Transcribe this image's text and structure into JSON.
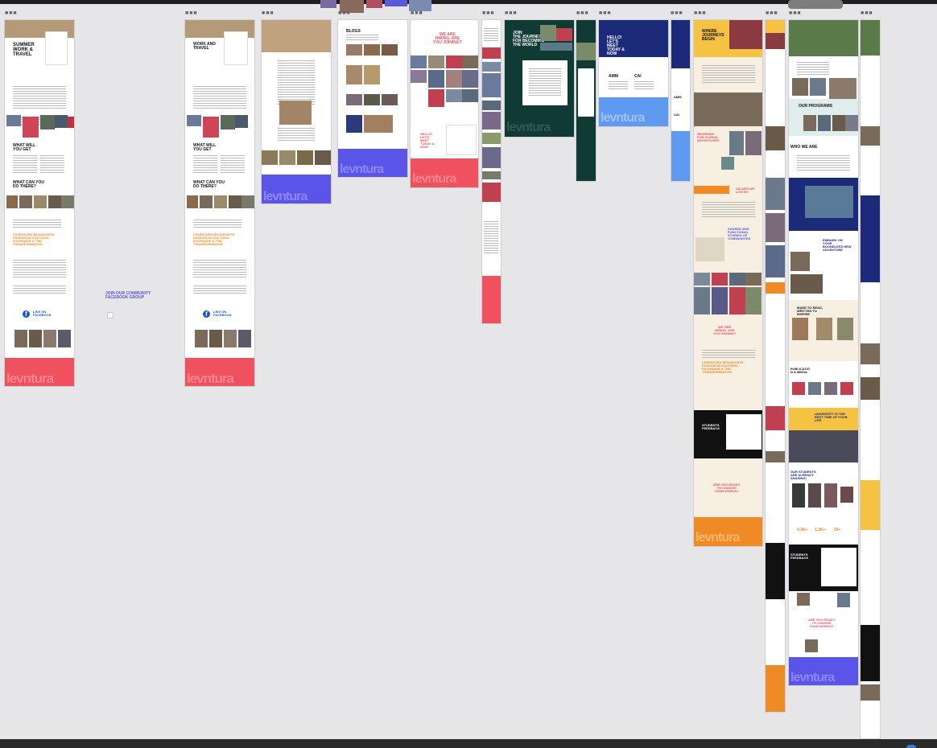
{
  "colors": {
    "canvas": "#e6e6e8",
    "coral": "#f0515f",
    "purple": "#5a54e8",
    "dark_green": "#0f3b34",
    "navy": "#1c2a7a",
    "orange": "#f08a24",
    "yellow": "#f5c242",
    "cream": "#f7efe2",
    "black": "#111111"
  },
  "frames": [
    {
      "label": "■■■",
      "kind": "landing-summer-work-travel"
    },
    {
      "label": "■■■",
      "kind": "landing-work-and-travel"
    },
    {
      "label": "■■■",
      "kind": "landing-cultural-exchange"
    },
    {
      "label": "■■■",
      "kind": "blogs"
    },
    {
      "label": "■■■",
      "kind": "we-are-hiring"
    },
    {
      "label": "■■■",
      "kind": "mobile-landing"
    },
    {
      "label": "■■■",
      "kind": "join-journey-dark"
    },
    {
      "label": "■■■",
      "kind": "mobile-dark"
    },
    {
      "label": "■■■",
      "kind": "contact-hello"
    },
    {
      "label": "■■■",
      "kind": "mobile-contact"
    },
    {
      "label": "■■■",
      "kind": "about-journeys"
    },
    {
      "label": "■■■",
      "kind": "mobile-about"
    },
    {
      "label": "■■■",
      "kind": "our-programs"
    },
    {
      "label": "■■■",
      "kind": "mobile-programs"
    }
  ],
  "text": {
    "summer_title": "SUMMER\nWORK &\nTRAVEL",
    "work_title": "WORK AND\nTRAVEL",
    "what_will_you_get": "WHAT WILL\nYOU GET",
    "what_can_you_do": "WHAT CAN YOU\nDO THERE?",
    "leventura_began": "LEVENTURA BEGAN WITH\nPASSION IN CULTURAL\nEXCHANGE & THE\nTRANSFORMATIVE",
    "like_on_facebook": "LIKE ON\nFACEBOOK",
    "join_community": "JOIN OUR COMMUNITY\nFACEBOOK GROUP",
    "blogs": "BLOGS",
    "we_are_hiring": "WE ARE\nHIRING. ARE\nYOU JOINING?",
    "hello_lets_meet": "HELLO!\nLET'S\nMEET\nTODAY &\nNOW",
    "join_journey": "JOIN\nTHE JOURNEY\nFOR BECOMING\nTHE WORLD",
    "amm": "AMM",
    "cai": "CAI",
    "where_journeys": "WHERE\nJOURNEYS\nBEGIN",
    "designed_for": "DESIGNED\nFOR GLOBAL\nADVENTURES",
    "values_we_live_by": "VALUES WE\nLIVE BY",
    "shared_stories": "SHARED AND\nFUNCTIONAL\nSTORIES OF\nCOMMUNITIES",
    "student_feedback": "STUDENTS\nFEEDBACK",
    "are_you_ready": "ARE YOU READY\nTO CHANGE\nYOUR WORLD?",
    "our_programs": "OUR PROGRAMS",
    "who_we_are": "WHO WE ARE",
    "embark": "EMBARK ON\nYOUR\nBOUNDLESS NEW\nADVENTURE",
    "made_to_read": "MADE TO READ,\nWRITTEN TO\nINSPIRE",
    "publications": "PUBLICATIO\nN & MEDIA",
    "university": "UNIVERSITY IS THE\nBEST TIME OF YOUR\nLIFE",
    "our_students": "OUR STUDENTS\nARE ALREADY\nSHARING!",
    "brand": "levntura",
    "stat1": "4.3K+",
    "stat2": "1.3K+",
    "stat3": "33+"
  }
}
